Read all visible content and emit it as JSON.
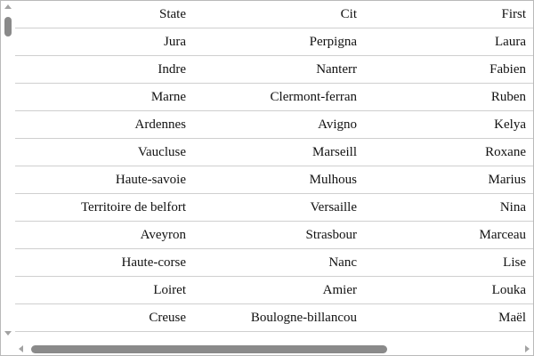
{
  "table": {
    "headers": {
      "state": "State",
      "city": "Cit",
      "first": "First"
    },
    "rows": [
      {
        "state": "Jura",
        "city": "Perpigna",
        "first": "Laura"
      },
      {
        "state": "Indre",
        "city": "Nanterr",
        "first": "Fabien"
      },
      {
        "state": "Marne",
        "city": "Clermont-ferran",
        "first": "Ruben"
      },
      {
        "state": "Ardennes",
        "city": "Avigno",
        "first": "Kelya"
      },
      {
        "state": "Vaucluse",
        "city": "Marseill",
        "first": "Roxane"
      },
      {
        "state": "Haute-savoie",
        "city": "Mulhous",
        "first": "Marius"
      },
      {
        "state": "Territoire de belfort",
        "city": "Versaille",
        "first": "Nina"
      },
      {
        "state": "Aveyron",
        "city": "Strasbour",
        "first": "Marceau"
      },
      {
        "state": "Haute-corse",
        "city": "Nanc",
        "first": "Lise"
      },
      {
        "state": "Loiret",
        "city": "Amier",
        "first": "Louka"
      },
      {
        "state": "Creuse",
        "city": "Boulogne-billancou",
        "first": "Maël"
      }
    ]
  },
  "scrollbars": {
    "vertical_icons": {
      "up": "triangle-up-icon",
      "down": "triangle-down-icon"
    },
    "horizontal_icons": {
      "left": "triangle-left-icon",
      "right": "triangle-right-icon"
    },
    "thumb_color": "#8a8a8a",
    "arrow_color": "#a3a3a3"
  }
}
